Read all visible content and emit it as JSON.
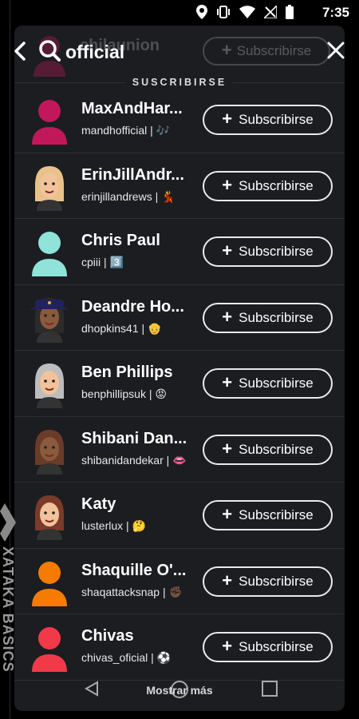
{
  "status_bar": {
    "time": "7:35"
  },
  "search": {
    "query": "official"
  },
  "behind": {
    "name": "chilaunion",
    "button": "Subscribirse"
  },
  "section": {
    "title": "SUSCRIBIRSE"
  },
  "subscribe_label": "Subscribirse",
  "results": [
    {
      "name": "MaxAndHar...",
      "handle": "mandhofficial",
      "emoji": "🎶",
      "avatar_color": "#c2185b",
      "avatar_type": "silhouette"
    },
    {
      "name": "ErinJillAndr...",
      "handle": "erinjillandrews",
      "emoji": "💃",
      "avatar_color": "#e9c28a",
      "avatar_type": "bitmoji-blonde"
    },
    {
      "name": "Chris Paul",
      "handle": "cpiii",
      "emoji": "3️⃣",
      "avatar_color": "#8fe3d8",
      "avatar_type": "silhouette"
    },
    {
      "name": "Deandre Ho...",
      "handle": "dhopkins41",
      "emoji": "👴",
      "avatar_color": "#2b2f6e",
      "avatar_type": "bitmoji-hat"
    },
    {
      "name": "Ben Phillips",
      "handle": "benphillipsuk",
      "emoji": "😡",
      "avatar_color": "#bdbdbd",
      "avatar_type": "bitmoji-grey"
    },
    {
      "name": "Shibani Dan...",
      "handle": "shibanidandekar",
      "emoji": "👄",
      "avatar_color": "#6b3b2a",
      "avatar_type": "bitmoji-dark"
    },
    {
      "name": "Katy",
      "handle": "lusterlux",
      "emoji": "🤔",
      "avatar_color": "#7a3b2a",
      "avatar_type": "bitmoji-katy"
    },
    {
      "name": "Shaquille O'...",
      "handle": "shaqattacksnap",
      "emoji": "✊🏿",
      "avatar_color": "#f57c00",
      "avatar_type": "silhouette"
    },
    {
      "name": "Chivas",
      "handle": "chivas_oficial",
      "emoji": "⚽",
      "avatar_color": "#f2394a",
      "avatar_type": "silhouette"
    }
  ],
  "footer": {
    "more_label": "Mostrar más"
  },
  "watermark": {
    "text": "XATAKA BASICS"
  },
  "colors": {
    "panel": "#1c1d21",
    "background": "#000000",
    "text": "#ffffff"
  }
}
